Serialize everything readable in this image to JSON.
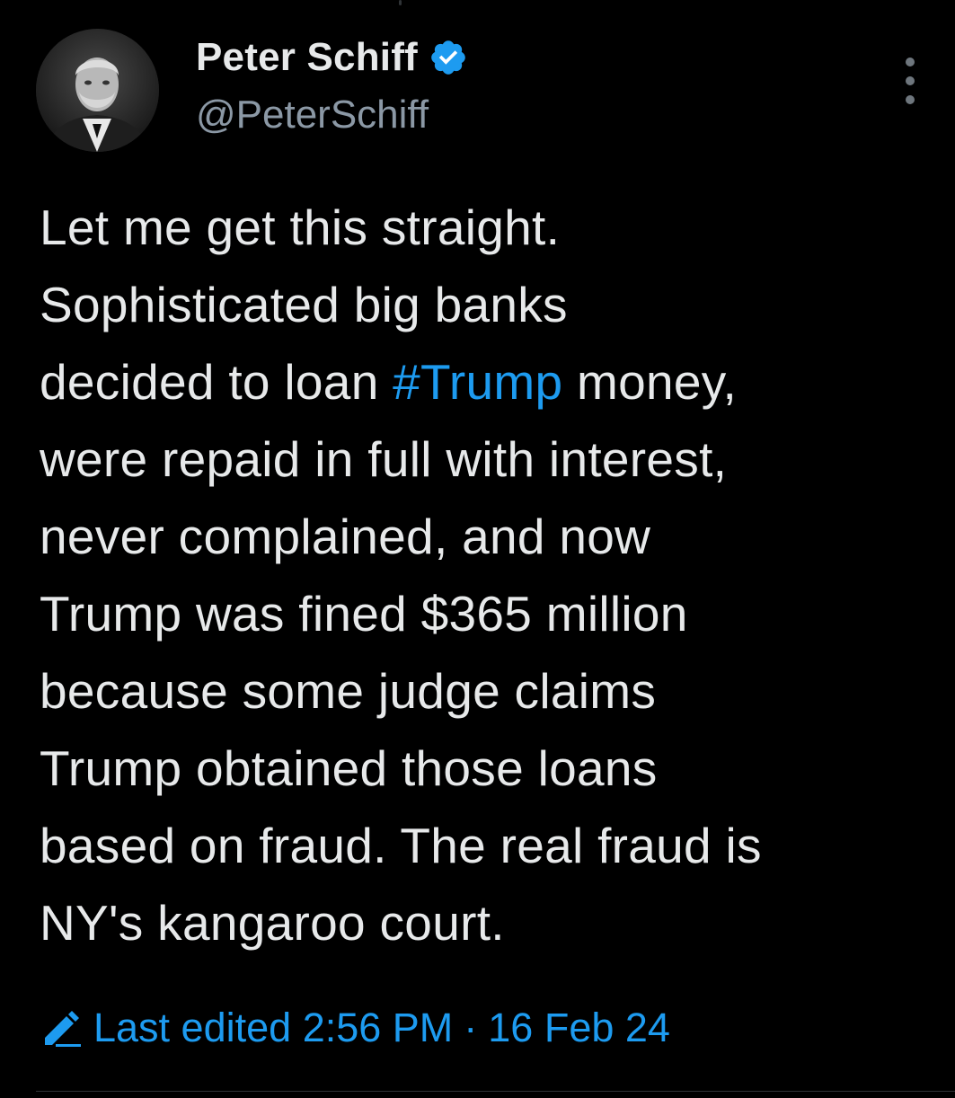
{
  "author": {
    "display_name": "Peter Schiff",
    "handle": "@PeterSchiff",
    "verified_icon": "verified-badge-icon",
    "avatar_icon": "avatar-photo"
  },
  "tweet": {
    "lines": [
      {
        "text": "Let me get this straight."
      },
      {
        "text": "Sophisticated big banks"
      },
      {
        "before": "decided to loan ",
        "hashtag": "#Trump",
        "after": " money,"
      },
      {
        "text": "were repaid in full with interest,"
      },
      {
        "text": "never complained, and now"
      },
      {
        "text": "Trump was fined $365 million"
      },
      {
        "text": "because some judge claims"
      },
      {
        "text": "Trump obtained those loans"
      },
      {
        "text": "based on fraud. The real fraud is"
      },
      {
        "text": "NY's kangaroo court."
      }
    ]
  },
  "edit_info": {
    "label": "Last edited",
    "time": "2:56 PM",
    "separator": "·",
    "date": "16 Feb 24",
    "icon": "pencil-edit-icon"
  },
  "colors": {
    "background": "#000000",
    "text": "#e7e9ea",
    "secondary": "#8b98a5",
    "accent": "#1d9bf0"
  }
}
